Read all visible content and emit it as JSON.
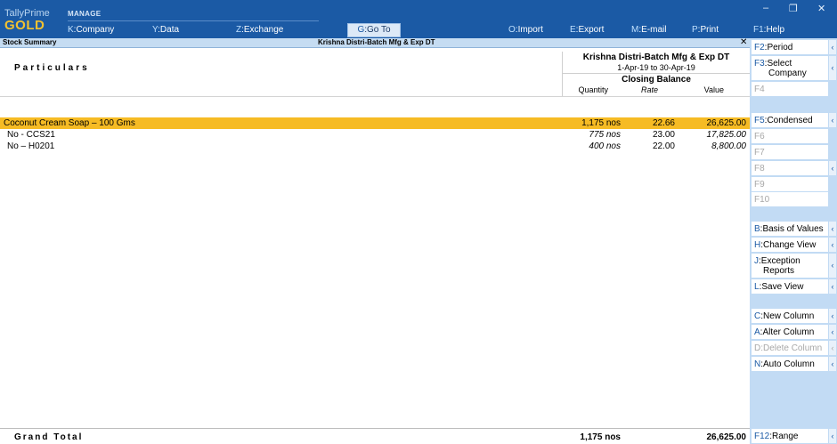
{
  "brand": {
    "app": "TallyPrime",
    "edition": "GOLD"
  },
  "top_menu": {
    "section_label": "MANAGE",
    "items": [
      {
        "key": "K",
        "label": "Company"
      },
      {
        "key": "Y",
        "label": "Data"
      },
      {
        "key": "Z",
        "label": "Exchange"
      },
      {
        "key": "G",
        "label": "Go To"
      },
      {
        "key": "O",
        "label": "Import"
      },
      {
        "key": "E",
        "label": "Export"
      },
      {
        "key": "M",
        "label": "E-mail"
      },
      {
        "key": "P",
        "label": "Print"
      },
      {
        "key": "F1",
        "label": "Help"
      }
    ]
  },
  "window_controls": {
    "minimize": "–",
    "restore": "❐",
    "close": "✕"
  },
  "title_strip": {
    "left": "Stock Summary",
    "center": "Krishna Distri-Batch Mfg & Exp DT",
    "close": "✕"
  },
  "report": {
    "particulars_header": "Particulars",
    "company": "Krishna Distri-Batch Mfg & Exp DT",
    "period": "1-Apr-19 to 30-Apr-19",
    "closing_balance": "Closing Balance",
    "columns": {
      "quantity": "Quantity",
      "rate": "Rate",
      "value": "Value"
    },
    "rows": [
      {
        "name": "Coconut Cream Soap – 100 Gms",
        "qty": "1,175 nos",
        "rate": "22.66",
        "value": "26,625.00",
        "selected": true
      },
      {
        "name": "No - CCS21",
        "qty": "775 nos",
        "rate": "23.00",
        "value": "17,825.00"
      },
      {
        "name": "No – H0201",
        "qty": "400 nos",
        "rate": "22.00",
        "value": "8,800.00"
      }
    ],
    "grand_total": {
      "label": "Grand Total",
      "qty": "1,175 nos",
      "value": "26,625.00"
    }
  },
  "sidebar": {
    "buttons": [
      {
        "key": "F2",
        "label": "Period",
        "enabled": true
      },
      {
        "key": "F3",
        "label": "Select",
        "label2": "Company",
        "enabled": true
      },
      {
        "key": "F4",
        "label": "",
        "enabled": false
      },
      {
        "key": "F5",
        "label": "Condensed",
        "enabled": true
      },
      {
        "key": "F6",
        "label": "",
        "enabled": false
      },
      {
        "key": "F7",
        "label": "",
        "enabled": false
      },
      {
        "key": "F8",
        "label": "",
        "enabled": false
      },
      {
        "key": "F9",
        "label": "",
        "enabled": false
      },
      {
        "key": "F10",
        "label": "",
        "enabled": false
      },
      {
        "key": "B",
        "label": "Basis of Values",
        "enabled": true
      },
      {
        "key": "H",
        "label": "Change View",
        "enabled": true
      },
      {
        "key": "J",
        "label": "Exception",
        "label2": "Reports",
        "enabled": true
      },
      {
        "key": "L",
        "label": "Save View",
        "enabled": true
      },
      {
        "key": "C",
        "label": "New Column",
        "enabled": true
      },
      {
        "key": "A",
        "label": "Alter Column",
        "enabled": true
      },
      {
        "key": "D",
        "label": "Delete Column",
        "enabled": false
      },
      {
        "key": "N",
        "label": "Auto Column",
        "enabled": true
      },
      {
        "key": "F12",
        "label": "Range",
        "enabled": true
      }
    ],
    "chevron": "‹"
  }
}
